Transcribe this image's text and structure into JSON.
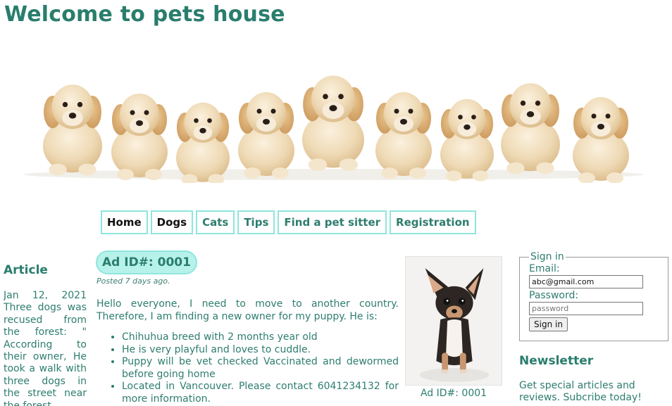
{
  "page": {
    "title": "Welcome to pets house"
  },
  "banner": {
    "alt": "puppies-banner"
  },
  "nav": {
    "items": [
      {
        "label": "Home",
        "style": "dark"
      },
      {
        "label": "Dogs",
        "style": "dark"
      },
      {
        "label": "Cats",
        "style": "accent"
      },
      {
        "label": "Tips",
        "style": "accent"
      },
      {
        "label": "Find a pet sitter",
        "style": "accent"
      },
      {
        "label": "Registration",
        "style": "accent"
      }
    ]
  },
  "article": {
    "title": "Article",
    "date": "Jan 12, 2021",
    "text": "Three dogs was recused from the forest: \" According to their owner, He took a walk with three dogs in the street near the forest"
  },
  "ad": {
    "badge": "Ad ID#: 0001",
    "posted": "Posted 7 days ago.",
    "intro": "Hello everyone, I need to move to another country. Therefore, I am finding a new owner for my puppy. He is:",
    "bullets": [
      "Chihuhua breed with 2 months year old",
      "He is very playful and loves to cuddle.",
      "Puppy will be vet checked Vaccinated and dewormed before going home",
      "Located in Vancouver. Please contact 6041234132 for more information."
    ],
    "photo_caption": "Ad ID#: 0001"
  },
  "signin": {
    "legend": "Sign in",
    "email_label": "Email:",
    "email_value": "abc@gmail.com",
    "password_label": "Password:",
    "password_placeholder": "password",
    "button_label": "Sign in"
  },
  "newsletter": {
    "title": "Newsletter",
    "text": "Get special articles and reviews. Subcribe today!"
  },
  "colors": {
    "heading": "#2a7d6d",
    "text": "#2e7d6f",
    "nav_border": "#8ee6dd",
    "badge_bg": "#b7f2ea"
  }
}
